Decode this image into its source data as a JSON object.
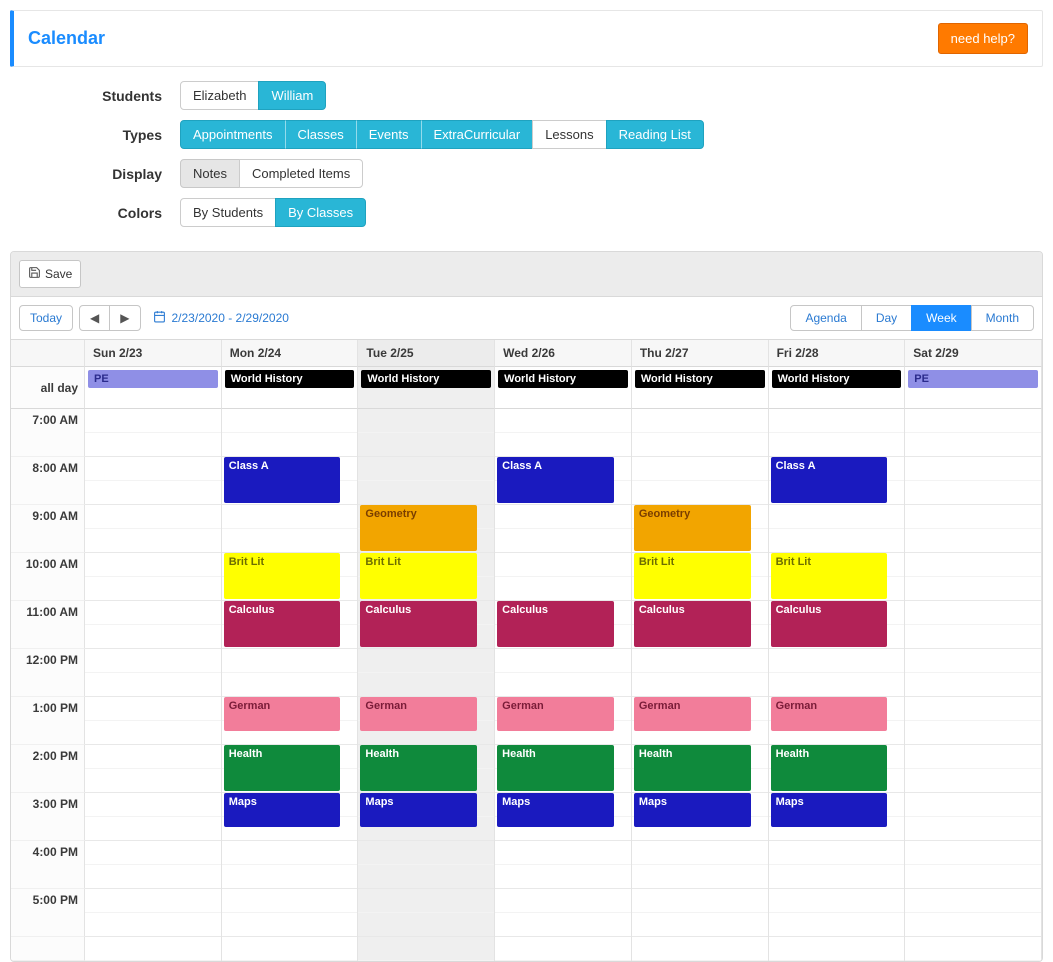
{
  "header": {
    "title": "Calendar",
    "help": "need help?"
  },
  "filters": {
    "students_label": "Students",
    "students": [
      {
        "label": "Elizabeth",
        "active": false
      },
      {
        "label": "William",
        "active": true
      }
    ],
    "types_label": "Types",
    "types": [
      {
        "label": "Appointments",
        "active": true
      },
      {
        "label": "Classes",
        "active": true
      },
      {
        "label": "Events",
        "active": true
      },
      {
        "label": "ExtraCurricular",
        "active": true
      },
      {
        "label": "Lessons",
        "active": false
      },
      {
        "label": "Reading List",
        "active": true
      }
    ],
    "display_label": "Display",
    "display": [
      {
        "label": "Notes",
        "active": true,
        "style": "grey"
      },
      {
        "label": "Completed Items",
        "active": false,
        "style": "grey"
      }
    ],
    "colors_label": "Colors",
    "colors": [
      {
        "label": "By Students",
        "active": false
      },
      {
        "label": "By Classes",
        "active": true
      }
    ]
  },
  "calendar": {
    "save": "Save",
    "today": "Today",
    "prev": "◀",
    "next": "▶",
    "date_range": "2/23/2020 - 2/29/2020",
    "views": [
      {
        "label": "Agenda",
        "active": false
      },
      {
        "label": "Day",
        "active": false
      },
      {
        "label": "Week",
        "active": true
      },
      {
        "label": "Month",
        "active": false
      }
    ],
    "allday_label": "all day",
    "days": [
      {
        "label": "Sun 2/23",
        "today": false
      },
      {
        "label": "Mon 2/24",
        "today": false
      },
      {
        "label": "Tue 2/25",
        "today": true
      },
      {
        "label": "Wed 2/26",
        "today": false
      },
      {
        "label": "Thu 2/27",
        "today": false
      },
      {
        "label": "Fri 2/28",
        "today": false
      },
      {
        "label": "Sat 2/29",
        "today": false
      }
    ],
    "time_slots": [
      "7:00 AM",
      "8:00 AM",
      "9:00 AM",
      "10:00 AM",
      "11:00 AM",
      "12:00 PM",
      "1:00 PM",
      "2:00 PM",
      "3:00 PM",
      "4:00 PM",
      "5:00 PM"
    ],
    "now_slot_index": 3,
    "allday_events": [
      {
        "day": 0,
        "label": "PE",
        "bg": "#8f8fe6",
        "fg": "#2b2b8c"
      },
      {
        "day": 1,
        "label": "World History",
        "bg": "#000000",
        "fg": "#ffffff"
      },
      {
        "day": 2,
        "label": "World History",
        "bg": "#000000",
        "fg": "#ffffff"
      },
      {
        "day": 3,
        "label": "World History",
        "bg": "#000000",
        "fg": "#ffffff"
      },
      {
        "day": 4,
        "label": "World History",
        "bg": "#000000",
        "fg": "#ffffff"
      },
      {
        "day": 5,
        "label": "World History",
        "bg": "#000000",
        "fg": "#ffffff"
      },
      {
        "day": 6,
        "label": "PE",
        "bg": "#8f8fe6",
        "fg": "#2b2b8c"
      }
    ],
    "events": [
      {
        "day": 1,
        "start": "8:00",
        "end": "9:00",
        "label": "Class A",
        "bg": "#1a1abf",
        "fg": "#ffffff"
      },
      {
        "day": 3,
        "start": "8:00",
        "end": "9:00",
        "label": "Class A",
        "bg": "#1a1abf",
        "fg": "#ffffff"
      },
      {
        "day": 5,
        "start": "8:00",
        "end": "9:00",
        "label": "Class A",
        "bg": "#1a1abf",
        "fg": "#ffffff"
      },
      {
        "day": 2,
        "start": "9:00",
        "end": "10:00",
        "label": "Geometry",
        "bg": "#f2a500",
        "fg": "#7a3e00"
      },
      {
        "day": 4,
        "start": "9:00",
        "end": "10:00",
        "label": "Geometry",
        "bg": "#f2a500",
        "fg": "#7a3e00"
      },
      {
        "day": 1,
        "start": "10:00",
        "end": "11:00",
        "label": "Brit Lit",
        "bg": "#ffff00",
        "fg": "#6e6e00"
      },
      {
        "day": 2,
        "start": "10:00",
        "end": "11:00",
        "label": "Brit Lit",
        "bg": "#ffff00",
        "fg": "#6e6e00"
      },
      {
        "day": 4,
        "start": "10:00",
        "end": "11:00",
        "label": "Brit Lit",
        "bg": "#ffff00",
        "fg": "#6e6e00"
      },
      {
        "day": 5,
        "start": "10:00",
        "end": "11:00",
        "label": "Brit Lit",
        "bg": "#ffff00",
        "fg": "#6e6e00"
      },
      {
        "day": 1,
        "start": "11:00",
        "end": "12:00",
        "label": "Calculus",
        "bg": "#b22257",
        "fg": "#ffffff"
      },
      {
        "day": 2,
        "start": "11:00",
        "end": "12:00",
        "label": "Calculus",
        "bg": "#b22257",
        "fg": "#ffffff"
      },
      {
        "day": 3,
        "start": "11:00",
        "end": "12:00",
        "label": "Calculus",
        "bg": "#b22257",
        "fg": "#ffffff"
      },
      {
        "day": 4,
        "start": "11:00",
        "end": "12:00",
        "label": "Calculus",
        "bg": "#b22257",
        "fg": "#ffffff"
      },
      {
        "day": 5,
        "start": "11:00",
        "end": "12:00",
        "label": "Calculus",
        "bg": "#b22257",
        "fg": "#ffffff"
      },
      {
        "day": 1,
        "start": "13:00",
        "end": "13:45",
        "label": "German",
        "bg": "#f27d9a",
        "fg": "#7a1c38"
      },
      {
        "day": 2,
        "start": "13:00",
        "end": "13:45",
        "label": "German",
        "bg": "#f27d9a",
        "fg": "#7a1c38"
      },
      {
        "day": 3,
        "start": "13:00",
        "end": "13:45",
        "label": "German",
        "bg": "#f27d9a",
        "fg": "#7a1c38"
      },
      {
        "day": 4,
        "start": "13:00",
        "end": "13:45",
        "label": "German",
        "bg": "#f27d9a",
        "fg": "#7a1c38"
      },
      {
        "day": 5,
        "start": "13:00",
        "end": "13:45",
        "label": "German",
        "bg": "#f27d9a",
        "fg": "#7a1c38"
      },
      {
        "day": 1,
        "start": "14:00",
        "end": "15:00",
        "label": "Health",
        "bg": "#0f8a3c",
        "fg": "#ffffff"
      },
      {
        "day": 2,
        "start": "14:00",
        "end": "15:00",
        "label": "Health",
        "bg": "#0f8a3c",
        "fg": "#ffffff"
      },
      {
        "day": 3,
        "start": "14:00",
        "end": "15:00",
        "label": "Health",
        "bg": "#0f8a3c",
        "fg": "#ffffff"
      },
      {
        "day": 4,
        "start": "14:00",
        "end": "15:00",
        "label": "Health",
        "bg": "#0f8a3c",
        "fg": "#ffffff"
      },
      {
        "day": 5,
        "start": "14:00",
        "end": "15:00",
        "label": "Health",
        "bg": "#0f8a3c",
        "fg": "#ffffff"
      },
      {
        "day": 1,
        "start": "15:00",
        "end": "15:45",
        "label": "Maps",
        "bg": "#1a1abf",
        "fg": "#ffffff"
      },
      {
        "day": 2,
        "start": "15:00",
        "end": "15:45",
        "label": "Maps",
        "bg": "#1a1abf",
        "fg": "#ffffff"
      },
      {
        "day": 3,
        "start": "15:00",
        "end": "15:45",
        "label": "Maps",
        "bg": "#1a1abf",
        "fg": "#ffffff"
      },
      {
        "day": 4,
        "start": "15:00",
        "end": "15:45",
        "label": "Maps",
        "bg": "#1a1abf",
        "fg": "#ffffff"
      },
      {
        "day": 5,
        "start": "15:00",
        "end": "15:45",
        "label": "Maps",
        "bg": "#1a1abf",
        "fg": "#ffffff"
      }
    ]
  }
}
